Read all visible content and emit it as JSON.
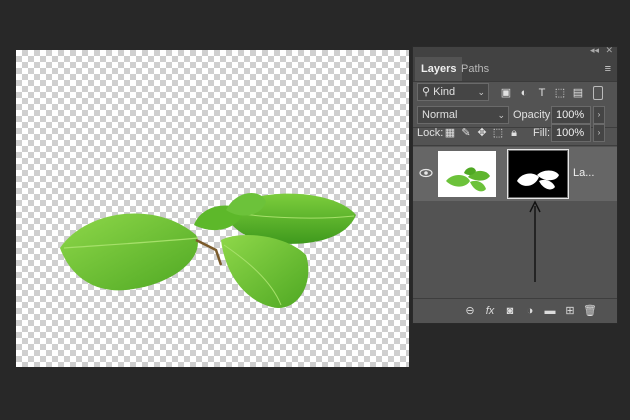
{
  "panel": {
    "tabs": [
      {
        "label": "Layers",
        "active": true
      },
      {
        "label": "Paths",
        "active": false
      }
    ],
    "collapse_glyph": "◂◂",
    "close_glyph": "✕",
    "filter": {
      "label": "Kind",
      "icon": "search-icon"
    },
    "blend_mode": "Normal",
    "opacity": {
      "label": "Opacity:",
      "value": "100%"
    },
    "lock": {
      "label": "Lock:"
    },
    "fill": {
      "label": "Fill:",
      "value": "100%"
    },
    "layer": {
      "name": "La...",
      "visible": true
    }
  },
  "colors": {
    "panel_bg": "#535353",
    "tab_bg": "#424242",
    "selected_row": "#666666",
    "leaf_green": "#6cc23a"
  }
}
